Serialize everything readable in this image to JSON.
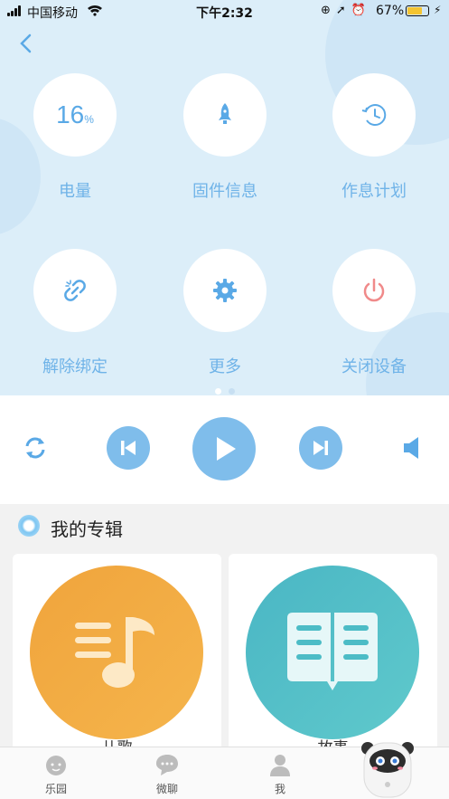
{
  "status_bar": {
    "carrier": "中国移动",
    "time": "下午2:32",
    "battery_percent": "67%",
    "battery_level": 0.67
  },
  "controls": {
    "battery": {
      "value": "16",
      "unit": "%",
      "label": "电量"
    },
    "firmware": {
      "label": "固件信息"
    },
    "schedule": {
      "label": "作息计划"
    },
    "unbind": {
      "label": "解除绑定"
    },
    "more": {
      "label": "更多"
    },
    "shutdown": {
      "label": "关闭设备"
    }
  },
  "pager": {
    "pages": 2,
    "active": 1
  },
  "albums": {
    "title": "我的专辑",
    "items": [
      {
        "label": "儿歌",
        "color": "#f0a43c",
        "icon": "music-note-icon"
      },
      {
        "label": "故事",
        "color": "#4cbcc6",
        "icon": "book-icon"
      }
    ]
  },
  "tabbar": {
    "items": [
      {
        "label": "乐园",
        "icon": "baby-face-icon"
      },
      {
        "label": "微聊",
        "icon": "chat-icon"
      },
      {
        "label": "我",
        "icon": "person-icon"
      }
    ]
  },
  "colors": {
    "accent": "#5aa9e6",
    "panel_bg": "#dceef9",
    "shutdown_red": "#f08a8a"
  }
}
